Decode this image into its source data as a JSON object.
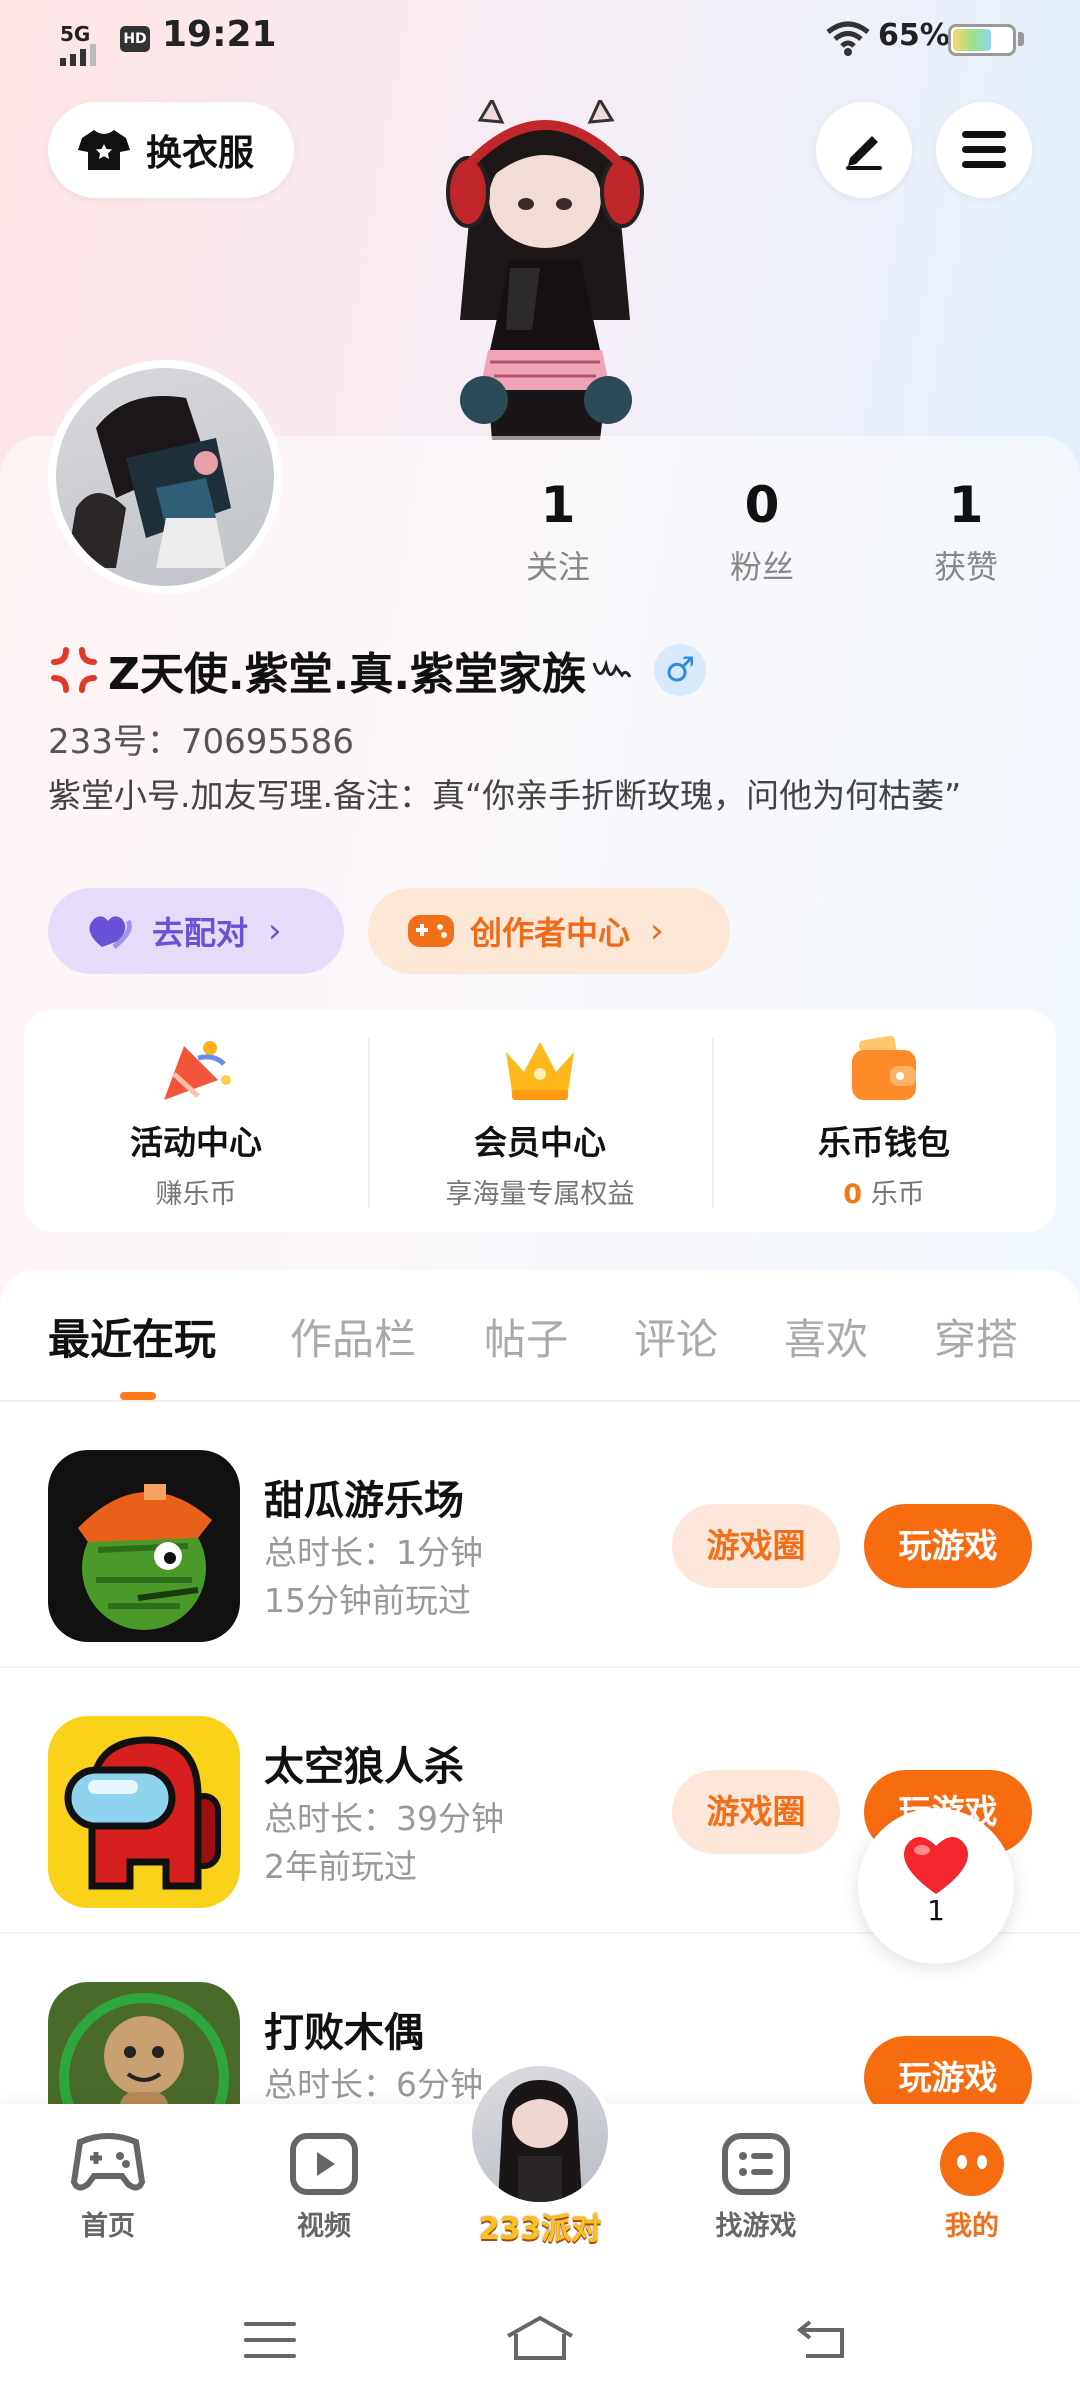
{
  "status_bar": {
    "network": "5G",
    "hd": "HD",
    "time": "19:21",
    "battery": "65%",
    "battery_level": 0.65
  },
  "header": {
    "outfit_button": "换衣服",
    "edit_icon": "pen-icon",
    "menu_icon": "hamburger-menu-icon"
  },
  "profile": {
    "stats": [
      {
        "value": "1",
        "label": "关注"
      },
      {
        "value": "0",
        "label": "粉丝"
      },
      {
        "value": "1",
        "label": "获赞"
      }
    ],
    "name": "Z天使.紫堂.真.紫堂家族",
    "gender_symbol": "♂",
    "uid": "233号：70695586",
    "bio": "紫堂小号.加友写理.备注：真“你亲手折断玫瑰，问他为何枯萎”",
    "chips": {
      "match": "去配对",
      "creator": "创作者中心"
    }
  },
  "quick_links": [
    {
      "title": "活动中心",
      "sub": "赚乐币",
      "icon": "party-popper-icon"
    },
    {
      "title": "会员中心",
      "sub": "享海量专属权益",
      "icon": "crown-icon"
    },
    {
      "title": "乐币钱包",
      "sub_value": "0",
      "sub_unit": "乐币",
      "icon": "wallet-icon"
    }
  ],
  "tabs": [
    "最近在玩",
    "作品栏",
    "帖子",
    "评论",
    "喜欢",
    "穿搭"
  ],
  "active_tab": "最近在玩",
  "games": [
    {
      "name": "甜瓜游乐场",
      "duration": "总时长：1分钟",
      "last": "15分钟前玩过",
      "circle": "游戏圈",
      "play": "玩游戏"
    },
    {
      "name": "太空狼人杀",
      "duration": "总时长：39分钟",
      "last": "2年前玩过",
      "circle": "游戏圈",
      "play": "玩游戏"
    },
    {
      "name": "打败木偶",
      "duration": "总时长：6分钟",
      "play": "玩游戏"
    }
  ],
  "like_widget": {
    "count": "1"
  },
  "bottom_nav": [
    {
      "label": "首页",
      "icon": "gamepad-icon"
    },
    {
      "label": "视频",
      "icon": "video-play-icon"
    },
    {
      "label": "233派对",
      "icon": "avatar-party-icon"
    },
    {
      "label": "找游戏",
      "icon": "list-icon"
    },
    {
      "label": "我的",
      "icon": "profile-face-icon"
    }
  ],
  "colors": {
    "accent": "#f86c10",
    "match_purple": "#6a52d8",
    "gender_blue": "#2b8be6"
  }
}
